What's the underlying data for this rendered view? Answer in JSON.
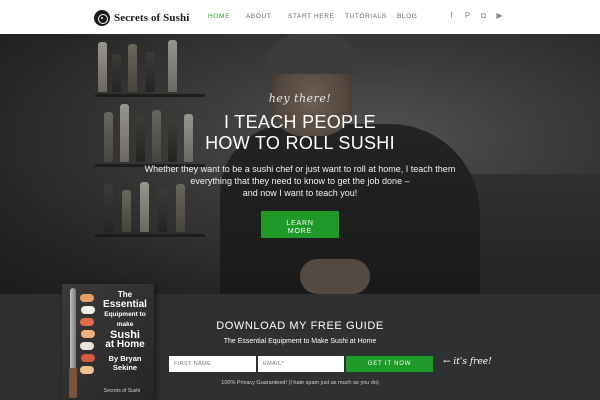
{
  "nav": {
    "brand": "Secrets of Sushi",
    "items": [
      {
        "label": "HOME",
        "active": true
      },
      {
        "label": "ABOUT",
        "active": false
      },
      {
        "label": "START HERE",
        "active": false
      },
      {
        "label": "TUTORIALS",
        "active": false
      },
      {
        "label": "BLOG",
        "active": false
      }
    ],
    "social": [
      "facebook-icon",
      "pinterest-icon",
      "instagram-icon",
      "youtube-icon"
    ]
  },
  "hero": {
    "greeting": "hey there!",
    "title_line1": "I TEACH PEOPLE",
    "title_line2": "HOW TO ROLL SUSHI",
    "sub_line1": "Whether they want to be a sushi chef or just want to roll at home, I teach them",
    "sub_line2": "everything that they need to know to get the job done –",
    "sub_line3": "and now I want to teach you!",
    "cta_line1": "LEARN",
    "cta_line2": "MORE"
  },
  "book": {
    "line1": "The",
    "line2": "Essential",
    "line3": "Equipment to make",
    "line4": "Sushi",
    "line5": "at Home",
    "author_by": "By Bryan",
    "author_last": "Sekine",
    "brand": "Secrets of Sushi"
  },
  "optin": {
    "title": "DOWNLOAD MY FREE GUIDE",
    "subtitle": "The Essential Equipment to Make Sushi at Home",
    "first_name_placeholder": "FIRST NAME",
    "email_placeholder": "EMAIL*",
    "submit_label": "GET IT NOW",
    "free_note": "← it's free!",
    "privacy": "100% Privacy Guaranteed! (I hate spam just as much as you do)"
  },
  "colors": {
    "accent": "#1f9a28",
    "nav_active": "#2aa52a",
    "dark_bg": "#2e3032"
  }
}
